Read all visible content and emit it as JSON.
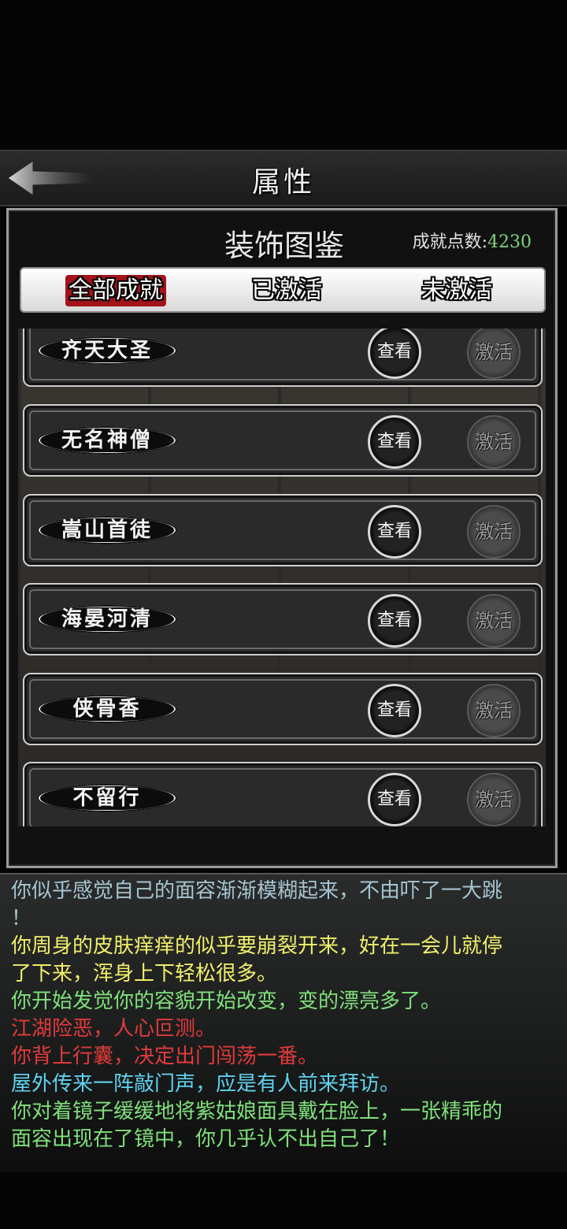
{
  "header": {
    "title": "属性",
    "back_icon": "arrow-left-icon"
  },
  "panel": {
    "title": "装饰图鉴",
    "score_label": "成就点数:",
    "score_value": "4230",
    "tabs": [
      {
        "label": "全部成就",
        "active": true
      },
      {
        "label": "已激活",
        "active": false
      },
      {
        "label": "未激活",
        "active": false
      }
    ]
  },
  "achievements": [
    {
      "name": "齐天大圣",
      "view_label": "查看",
      "activate_label": "激活"
    },
    {
      "name": "无名神僧",
      "view_label": "查看",
      "activate_label": "激活"
    },
    {
      "name": "嵩山首徒",
      "view_label": "查看",
      "activate_label": "激活"
    },
    {
      "name": "海晏河清",
      "view_label": "查看",
      "activate_label": "激活"
    },
    {
      "name": "侠骨香",
      "view_label": "查看",
      "activate_label": "激活"
    },
    {
      "name": "不留行",
      "view_label": "查看",
      "activate_label": "激活"
    }
  ],
  "log": [
    {
      "text": "你似乎感觉自己的面容渐渐模糊起来，不由吓了一大跳",
      "color": "#a6c3cf"
    },
    {
      "text": "！",
      "color": "#a6c3cf"
    },
    {
      "text": "你周身的皮肤痒痒的似乎要崩裂开来，好在一会儿就停",
      "color": "#f1ef6a"
    },
    {
      "text": "了下来，浑身上下轻松很多。",
      "color": "#f1ef6a"
    },
    {
      "text": "你开始发觉你的容貌开始改变，变的漂亮多了。",
      "color": "#7fe07a"
    },
    {
      "text": "江湖险恶，人心叵测。",
      "color": "#e23a3a"
    },
    {
      "text": "你背上行囊，决定出门闯荡一番。",
      "color": "#e23a3a"
    },
    {
      "text": "屋外传来一阵敲门声，应是有人前来拜访。",
      "color": "#5fd3ee"
    },
    {
      "text": "你对着镜子缓缓地将紫姑娘面具戴在脸上，一张精乖的",
      "color": "#7fe07a"
    },
    {
      "text": "面容出现在了镜中，你几乎认不出自己了！",
      "color": "#7fe07a"
    }
  ],
  "colors": {
    "active_tab": "#a3131a",
    "score": "#7fd27f"
  }
}
